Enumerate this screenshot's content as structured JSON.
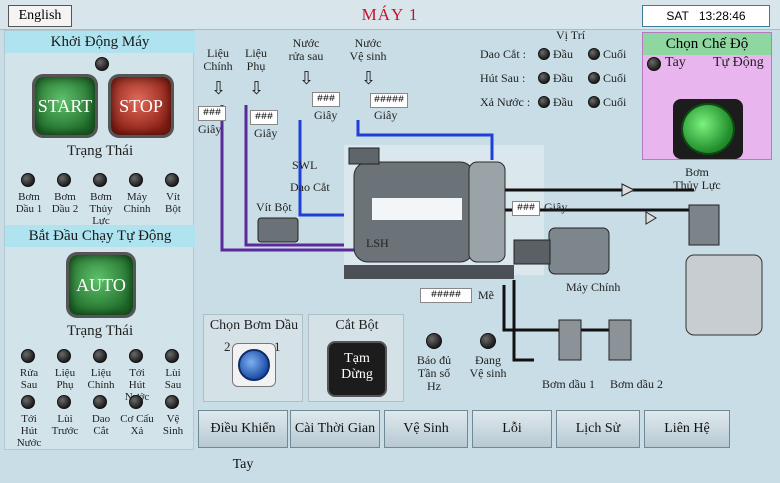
{
  "topbar": {
    "language_button": "English",
    "machine_title": "MÁY  1",
    "clock_day": "SAT",
    "clock_time": "13:28:46"
  },
  "left_panel": {
    "startup_title": "Khởi Động Máy",
    "start_label": "START",
    "stop_label": "STOP",
    "status_title_1": "Trạng Thái",
    "status_lamps_1": [
      {
        "line1": "Bơm",
        "line2": "Dầu 1"
      },
      {
        "line1": "Bơm",
        "line2": "Dầu 2"
      },
      {
        "line1": "Bơm",
        "line2": "Thủy Lực"
      },
      {
        "line1": "Máy",
        "line2": "Chính"
      },
      {
        "line1": "Vít",
        "line2": "Bột"
      }
    ],
    "auto_title": "Bắt Đầu Chạy Tự Động",
    "auto_label": "AUTO",
    "status_title_2": "Trạng Thái",
    "status_lamps_2": [
      {
        "line1": "Rửa",
        "line2": "Sau"
      },
      {
        "line1": "Liệu",
        "line2": "Phụ"
      },
      {
        "line1": "Liệu",
        "line2": "Chính"
      },
      {
        "line1": "Tới",
        "line2": "Hút Nước"
      },
      {
        "line1": "Lùi",
        "line2": "Sau"
      }
    ],
    "status_lamps_3": [
      {
        "line1": "Tới",
        "line2": "Hút Nước"
      },
      {
        "line1": "Lùi",
        "line2": "Trước"
      },
      {
        "line1": "Dao",
        "line2": "Cắt"
      },
      {
        "line1": "Cơ Cấu",
        "line2": "Xả"
      },
      {
        "line1": "Vệ",
        "line2": "Sinh"
      }
    ]
  },
  "process": {
    "feeds": [
      {
        "line1": "Liệu",
        "line2": "Chính"
      },
      {
        "line1": "Liệu",
        "line2": "Phụ"
      },
      {
        "line1": "Nước",
        "line2": "rửa sau"
      },
      {
        "line1": "Nước",
        "line2": "Vệ sinh"
      }
    ],
    "timer_1": "###",
    "timer_2": "###",
    "timer_3": "###",
    "timer_4": "#####",
    "timer_unit": "Giây",
    "swl_label": "SWL",
    "dao_cat_label": "Dao Cắt",
    "lsh_label": "LSH",
    "vit_bot_label": "Vít Bột",
    "pump_timer": "###",
    "pump_timer_unit": "Giây",
    "hydraulic_pump_label_1": "Bơm",
    "hydraulic_pump_label_2": "Thủy Lực",
    "main_motor_label": "Máy  Chính",
    "speed_value": "#####",
    "speed_unit": "Mẽ",
    "oil_pump_1": "Bơm dầu 1",
    "oil_pump_2": "Bơm dầu 2"
  },
  "position": {
    "title": "Vị Trí",
    "rows": [
      {
        "name": "Dao Cắt :",
        "opt1": "Đầu",
        "opt2": "Cuối"
      },
      {
        "name": "Hút Sau :",
        "opt1": "Đầu",
        "opt2": "Cuối"
      },
      {
        "name": "Xả Nước :",
        "opt1": "Đầu",
        "opt2": "Cuối"
      }
    ]
  },
  "mode": {
    "title": "Chọn Chế Độ",
    "manual": "Tay",
    "auto": "Tự Động"
  },
  "pump_select": {
    "title": "Chọn Bơm Dầu",
    "left_num": "2",
    "right_num": "1"
  },
  "cut_powder": {
    "title": "Cắt Bột",
    "button_line1": "Tạm",
    "button_line2": "Dừng"
  },
  "indicators": [
    {
      "line1": "Báo đủ",
      "line2": "Tần số",
      "line3": "Hz"
    },
    {
      "line1": "Đang",
      "line2": "Vệ sinh",
      "line3": ""
    }
  ],
  "bottom_nav": [
    "Điều Khiển Tay",
    "Cài Thời Gian",
    "Vệ Sinh",
    "Lỗi",
    "Lịch Sử",
    "Liên Hệ"
  ],
  "colors": {
    "title_red": "#c8102e",
    "section_cyan": "#aee3ef",
    "mode_pink": "#e9b5ef",
    "pipe_blue": "#1f3fd8",
    "pipe_purple": "#5a2a9a"
  }
}
